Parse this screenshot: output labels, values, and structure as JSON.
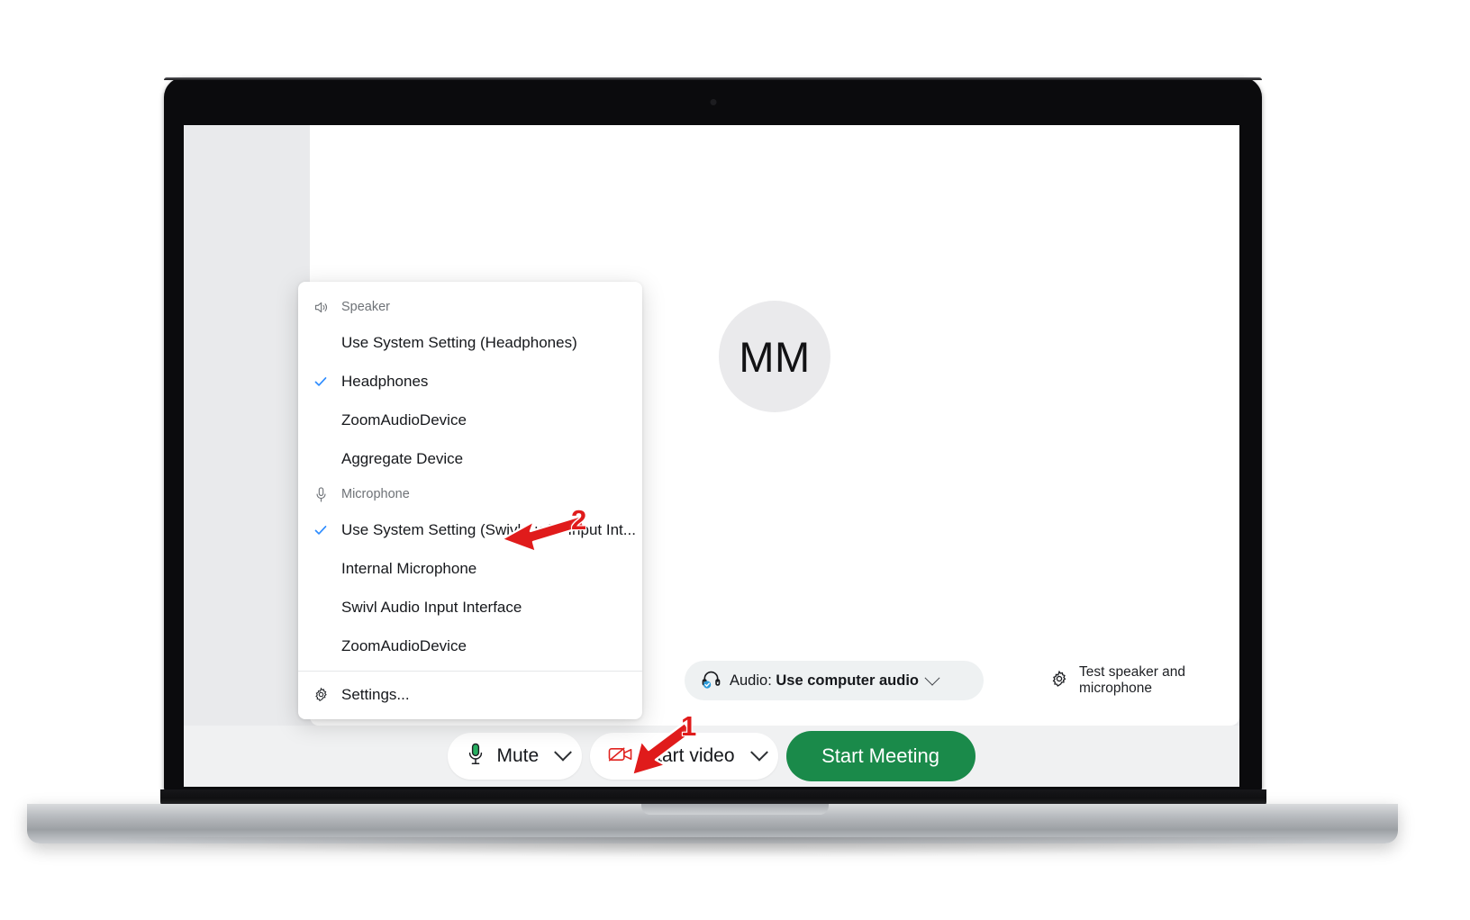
{
  "app": {
    "avatar_initials": "MM"
  },
  "dropdown": {
    "speaker": {
      "section_label": "Speaker",
      "section_icon": "speaker-icon",
      "items": [
        {
          "label": "Use System Setting (Headphones)",
          "checked": false
        },
        {
          "label": "Headphones",
          "checked": true
        },
        {
          "label": "ZoomAudioDevice",
          "checked": false
        },
        {
          "label": "Aggregate Device",
          "checked": false
        }
      ]
    },
    "microphone": {
      "section_label": "Microphone",
      "section_icon": "microphone-icon",
      "items": [
        {
          "label": "Use System Setting (Swivl Audio Input Int...",
          "checked": true
        },
        {
          "label": "Internal Microphone",
          "checked": false
        },
        {
          "label": "Swivl Audio Input Interface",
          "checked": false
        },
        {
          "label": "ZoomAudioDevice",
          "checked": false
        }
      ]
    },
    "settings": {
      "label": "Settings...",
      "icon": "gear-icon"
    },
    "check_color": "#2d8cff"
  },
  "audio_row": {
    "status_icon": "headset-check-icon",
    "prefix": "Audio: ",
    "value": "Use computer audio",
    "caret_icon": "chevron-down-icon",
    "test_link": {
      "icon": "gear-icon",
      "label": "Test speaker and microphone"
    }
  },
  "toolbar": {
    "mute": {
      "icon": "microphone-icon",
      "label": "Mute",
      "caret_icon": "chevron-down-icon"
    },
    "start_video": {
      "icon": "video-off-icon",
      "label": "Start video",
      "caret_icon": "chevron-down-icon"
    },
    "start_meeting": {
      "label": "Start Meeting",
      "color": "#1a8a4a"
    }
  },
  "annotations": [
    {
      "number": "1",
      "color": "#e01b1b",
      "target": "mute-dropdown-caret"
    },
    {
      "number": "2",
      "color": "#e01b1b",
      "target": "microphone-selected-item"
    }
  ]
}
